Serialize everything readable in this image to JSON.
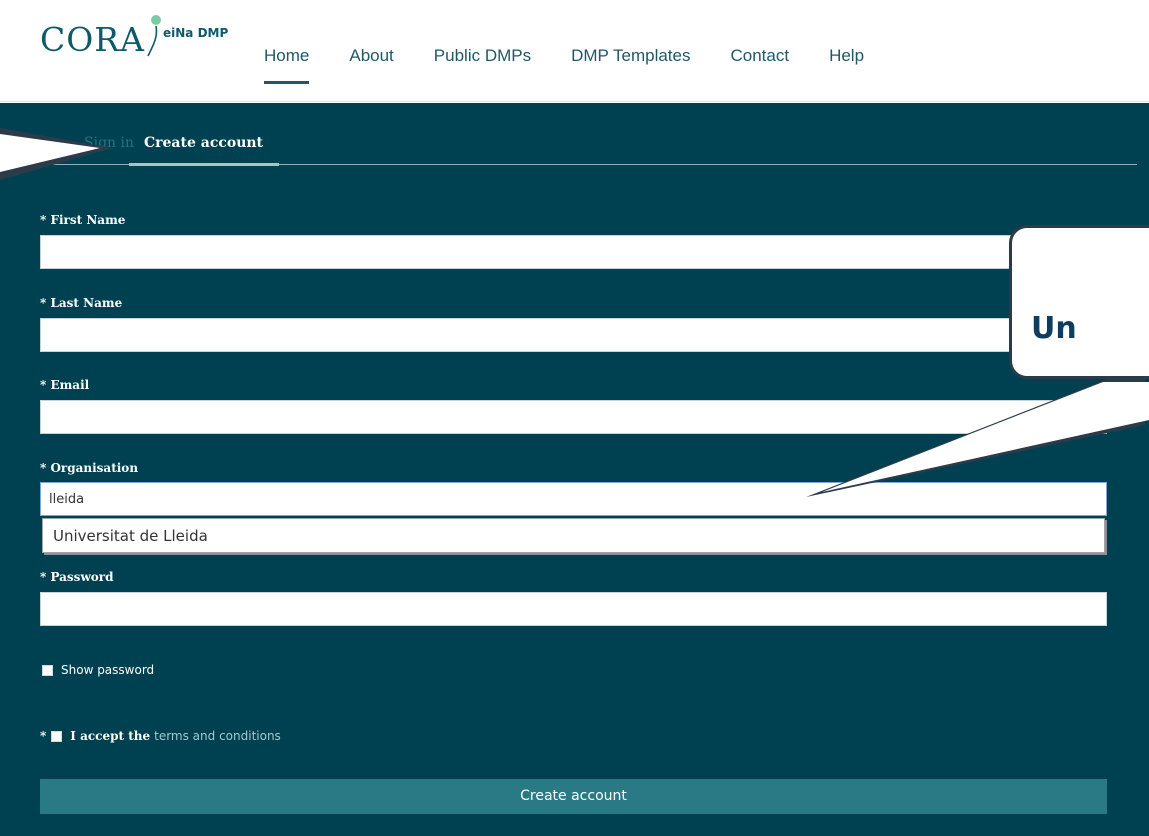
{
  "header": {
    "logo_text": "CORA",
    "logo_subtitle": "eiNa DMP",
    "nav": [
      {
        "label": "Home"
      },
      {
        "label": "About"
      },
      {
        "label": "Public DMPs"
      },
      {
        "label": "DMP Templates"
      },
      {
        "label": "Contact"
      },
      {
        "label": "Help"
      }
    ],
    "active_nav": "Home"
  },
  "tabs": {
    "sign_in": "Sign in",
    "create": "Create account"
  },
  "form": {
    "first_name": {
      "label": "* First Name",
      "value": ""
    },
    "last_name": {
      "label": "* Last Name",
      "value": ""
    },
    "email": {
      "label": "* Email",
      "value": ""
    },
    "organisation": {
      "label": "* Organisation",
      "value": "lleida"
    },
    "organisation_suggestion": "Universitat de Lleida",
    "password": {
      "label": "* Password",
      "value": ""
    },
    "show_password": "Show password",
    "accept_star": "*",
    "accept_prefix": "I accept the",
    "terms_link": "terms and conditions",
    "submit": "Create account"
  },
  "callout": {
    "text": "Un"
  },
  "colors": {
    "panel_bg": "#004151",
    "brand": "#0f5a6a",
    "button": "#2a7a86",
    "link": "#a6c8cf"
  }
}
